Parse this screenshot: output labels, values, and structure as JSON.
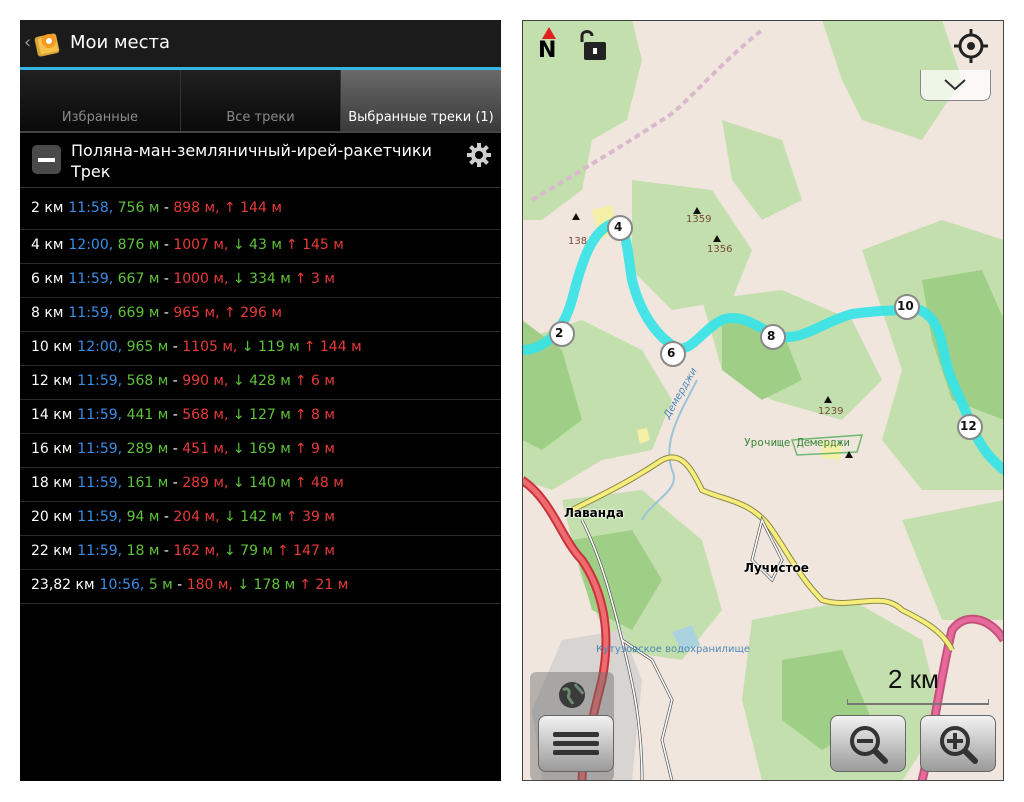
{
  "left_panel": {
    "title": "Мои места",
    "back_glyph": "‹",
    "tabs": [
      {
        "label": "Избранные",
        "selected": false
      },
      {
        "label": "Все треки",
        "selected": false
      },
      {
        "label": "Выбранные треки (1)",
        "selected": true
      }
    ],
    "track": {
      "name": "Поляна-ман-земляничный-ирей-ракетчики",
      "type": "Трек"
    },
    "segments": [
      {
        "dist": "2 км",
        "time": "11:58",
        "sep1": ", ",
        "elev": "756 м",
        "sep2": " - ",
        "max": "898 м",
        "sep3": ", ",
        "down": "",
        "up": "↑ 144 м"
      },
      {
        "dist": "4 км",
        "time": "12:00",
        "sep1": ", ",
        "elev": "876 м",
        "sep2": " - ",
        "max": "1007 м",
        "sep3": ", ",
        "down": "↓ 43 м",
        "up": "↑ 145 м"
      },
      {
        "dist": "6 км",
        "time": "11:59",
        "sep1": ", ",
        "elev": "667 м",
        "sep2": " - ",
        "max": "1000 м",
        "sep3": ", ",
        "down": "↓ 334 м",
        "up": "↑ 3 м"
      },
      {
        "dist": "8 км",
        "time": "11:59",
        "sep1": ", ",
        "elev": "669 м",
        "sep2": " - ",
        "max": "965 м",
        "sep3": ", ",
        "down": "",
        "up": "↑ 296 м"
      },
      {
        "dist": "10 км",
        "time": "12:00",
        "sep1": ", ",
        "elev": "965 м",
        "sep2": " - ",
        "max": "1105 м",
        "sep3": ", ",
        "down": "↓ 119 м",
        "up": "↑ 144 м"
      },
      {
        "dist": "12 км",
        "time": "11:59",
        "sep1": ", ",
        "elev": "568 м",
        "sep2": " - ",
        "max": "990 м",
        "sep3": ", ",
        "down": "↓ 428 м",
        "up": "↑ 6 м"
      },
      {
        "dist": "14 км",
        "time": "11:59",
        "sep1": ", ",
        "elev": "441 м",
        "sep2": " - ",
        "max": "568 м",
        "sep3": ", ",
        "down": "↓ 127 м",
        "up": "↑ 8 м"
      },
      {
        "dist": "16 км",
        "time": "11:59",
        "sep1": ", ",
        "elev": "289 м",
        "sep2": " - ",
        "max": "451 м",
        "sep3": ", ",
        "down": "↓ 169 м",
        "up": "↑ 9 м"
      },
      {
        "dist": "18 км",
        "time": "11:59",
        "sep1": ", ",
        "elev": "161 м",
        "sep2": " - ",
        "max": "289 м",
        "sep3": ", ",
        "down": "↓ 140 м",
        "up": "↑ 48 м"
      },
      {
        "dist": "20 км",
        "time": "11:59",
        "sep1": ", ",
        "elev": "94 м",
        "sep2": " - ",
        "max": "204 м",
        "sep3": ", ",
        "down": "↓ 142 м",
        "up": "↑ 39 м"
      },
      {
        "dist": "22 км",
        "time": "11:59",
        "sep1": ", ",
        "elev": "18 м",
        "sep2": " - ",
        "max": "162 м",
        "sep3": ", ",
        "down": "↓ 79 м",
        "up": "↑ 147 м"
      },
      {
        "dist": "23,82 км",
        "time": "10:56",
        "sep1": ", ",
        "elev": "5 м",
        "sep2": " - ",
        "max": "180 м",
        "sep3": ", ",
        "down": "↓ 178 м",
        "up": "↑ 21 м"
      }
    ]
  },
  "map_panel": {
    "north_label": "N",
    "labels": {
      "peak_138": "138",
      "peak_1359": "1359",
      "peak_1356": "1356",
      "peak_1239": "1239",
      "river": "Демерджи",
      "tract": "Урочище Демерджи",
      "village_lavanda": "Лаванда",
      "village_luchistoe": "Лучистое",
      "reservoir": "Кутузовское водохранилище"
    },
    "markers": [
      "2",
      "4",
      "6",
      "8",
      "10",
      "12"
    ],
    "scale_label": "2 км"
  },
  "colors": {
    "accent_blue": "#33b5e5",
    "time_blue": "#3a8ee6",
    "elev_green": "#5fc23a",
    "max_red": "#e83a3a",
    "track_cyan": "#34e3e8"
  },
  "icons": [
    "app-icon",
    "settings-icon",
    "north-arrow-icon",
    "lock-open-icon",
    "my-location-icon",
    "chevron-down-icon",
    "globe-icon",
    "menu-icon",
    "zoom-out-icon",
    "zoom-in-icon"
  ]
}
